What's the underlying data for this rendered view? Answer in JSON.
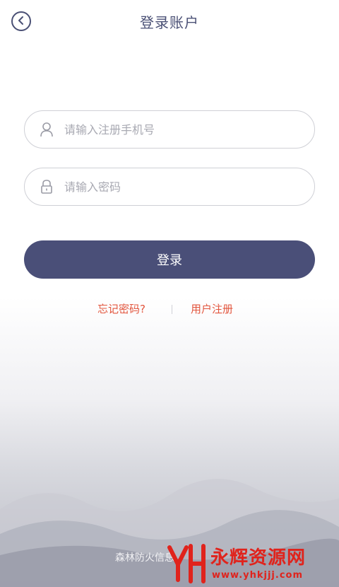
{
  "header": {
    "title": "登录账户"
  },
  "form": {
    "phone_placeholder": "请输入注册手机号",
    "password_placeholder": "请输入密码",
    "login_label": "登录"
  },
  "links": {
    "forgot": "忘记密码?",
    "register": "用户注册"
  },
  "footer": {
    "text": "森林防火信息"
  },
  "watermark": {
    "brand": "永辉资源网",
    "url": "www.yhkjjj.com"
  },
  "colors": {
    "primary": "#4a4f78",
    "accent_link": "#e2553d",
    "watermark": "#e0231c"
  },
  "icons": {
    "back": "chevron-left-icon",
    "user": "user-icon",
    "lock": "lock-icon"
  }
}
